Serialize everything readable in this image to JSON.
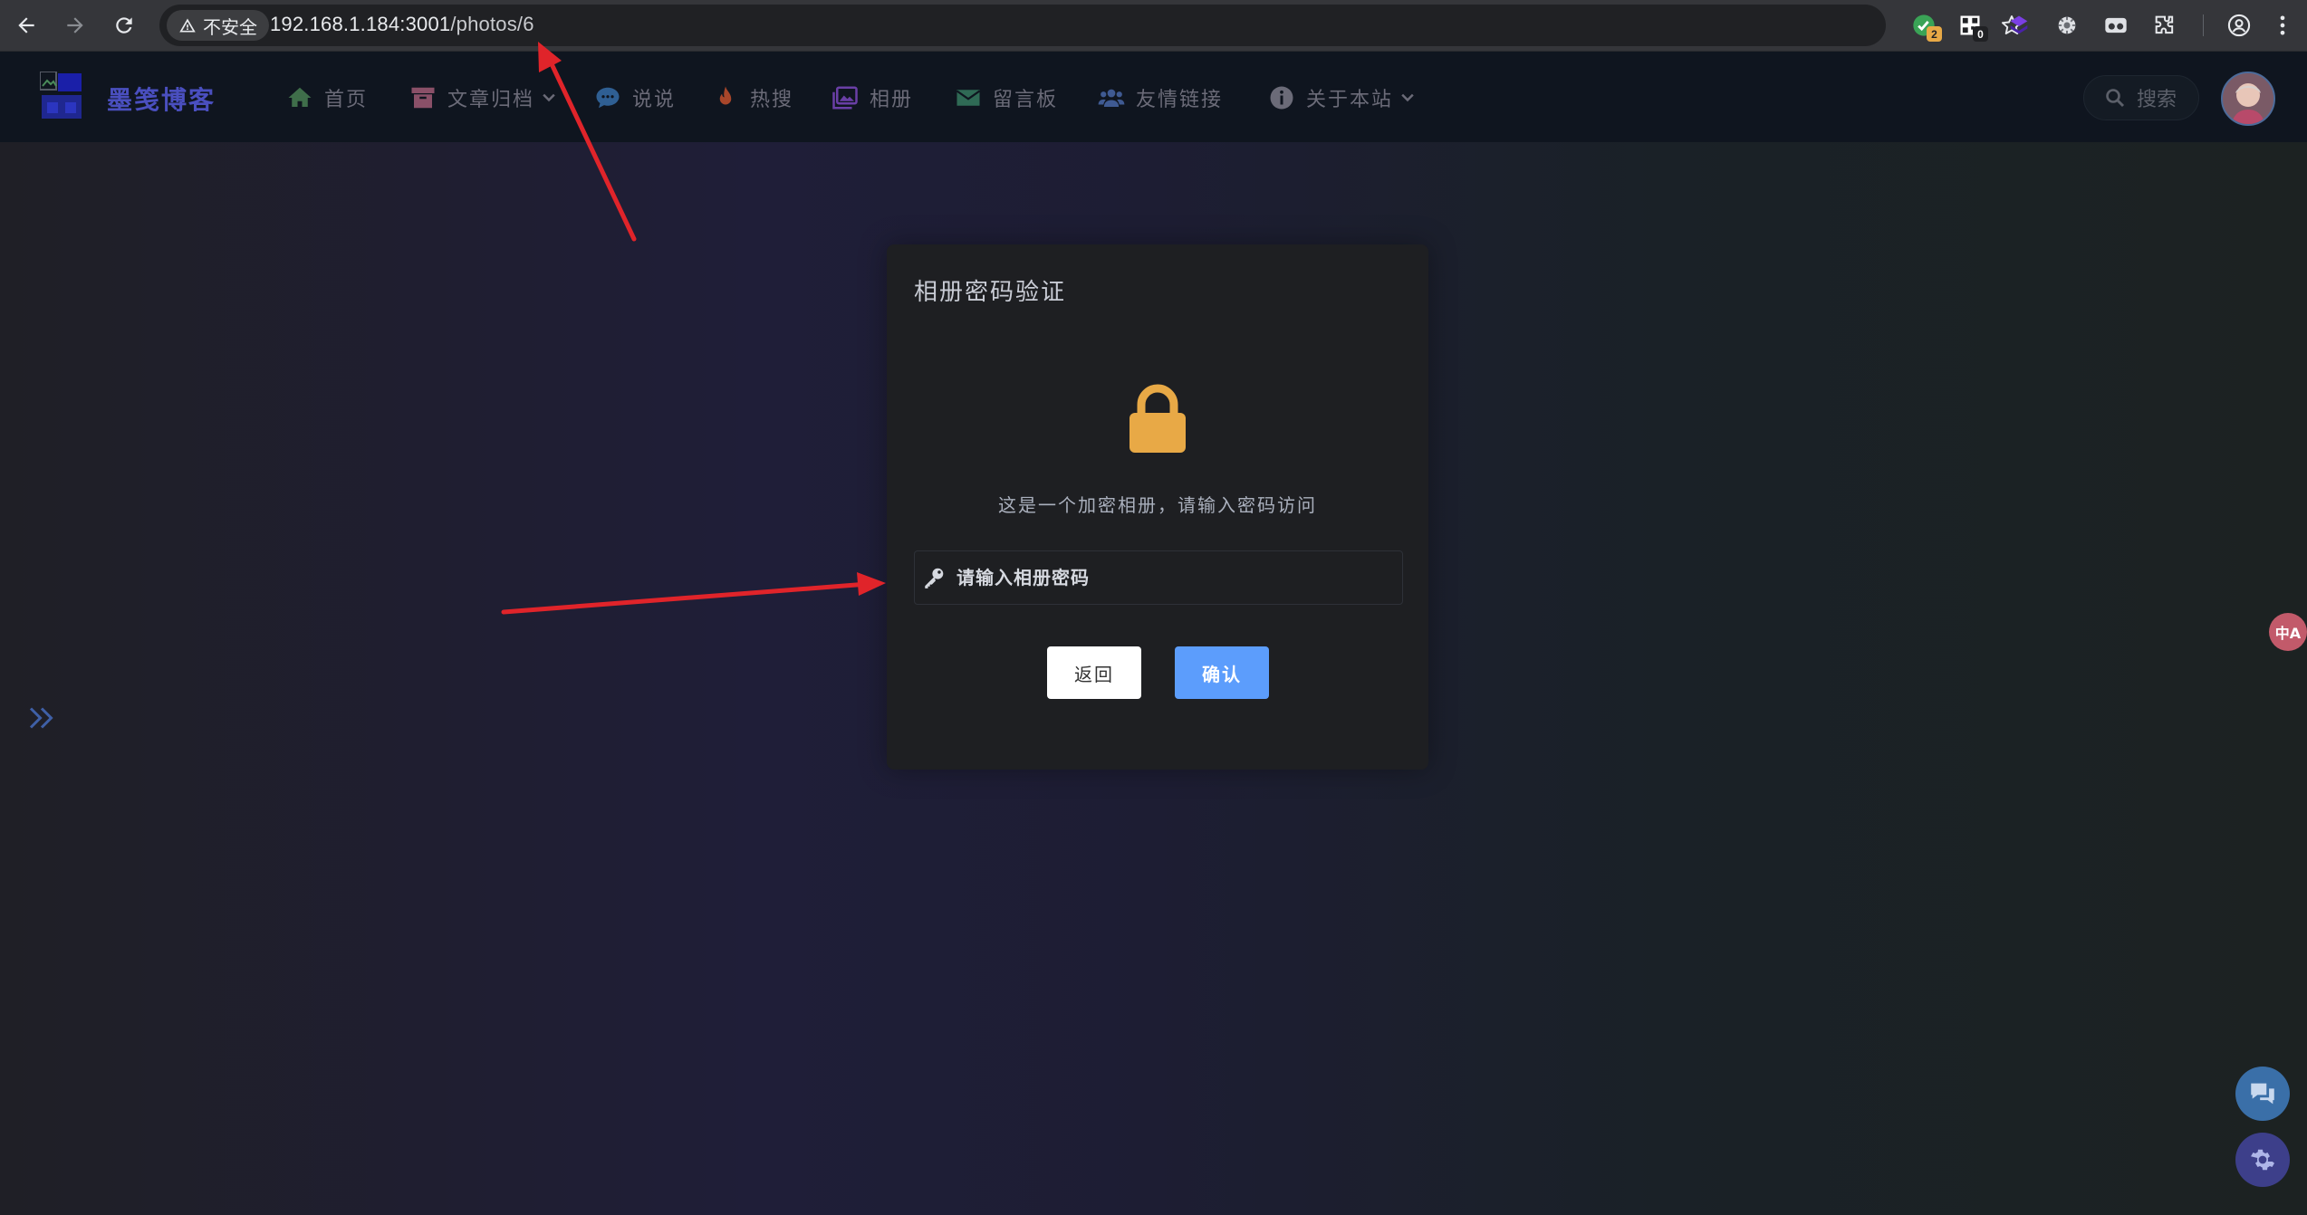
{
  "browser": {
    "security_label": "不安全",
    "url_host": "192.168.1.184:3001",
    "url_path": "/photos/6",
    "extensions": [
      {
        "name": "grammar-ext",
        "badge": "2"
      },
      {
        "name": "qr-ext",
        "badge": "0"
      },
      {
        "name": "purple-cube-ext",
        "badge": ""
      },
      {
        "name": "gear-ext",
        "badge": ""
      },
      {
        "name": "glasses-ext",
        "badge": ""
      }
    ]
  },
  "site": {
    "name": "墨笺博客",
    "menu": [
      {
        "label": "首页",
        "icon": "home-icon",
        "color": "#3f6e4a"
      },
      {
        "label": "文章归档",
        "icon": "archive-icon",
        "color": "#8a5068",
        "dropdown": true
      },
      {
        "label": "说说",
        "icon": "comment-icon",
        "color": "#2f5f93"
      },
      {
        "label": "热搜",
        "icon": "fire-icon",
        "color": "#a8462a"
      },
      {
        "label": "相册",
        "icon": "image-icon",
        "color": "#6a3fa6"
      },
      {
        "label": "留言板",
        "icon": "envelope-icon",
        "color": "#2f6a55"
      },
      {
        "label": "友情链接",
        "icon": "users-icon",
        "color": "#3f5a92"
      },
      {
        "label": "关于本站",
        "icon": "info-icon",
        "color": "#6b6b78",
        "dropdown": true
      }
    ],
    "search_label": "搜索"
  },
  "modal": {
    "title": "相册密码验证",
    "message": "这是一个加密相册，请输入密码访问",
    "password_placeholder": "请输入相册密码",
    "back_label": "返回",
    "confirm_label": "确认"
  },
  "float": {
    "translate_label": "中A"
  },
  "colors": {
    "accent": "#5c9dfc",
    "lock": "#e8a946",
    "annotation_arrow": "#e0242a",
    "header_bg": "#0f151f"
  }
}
